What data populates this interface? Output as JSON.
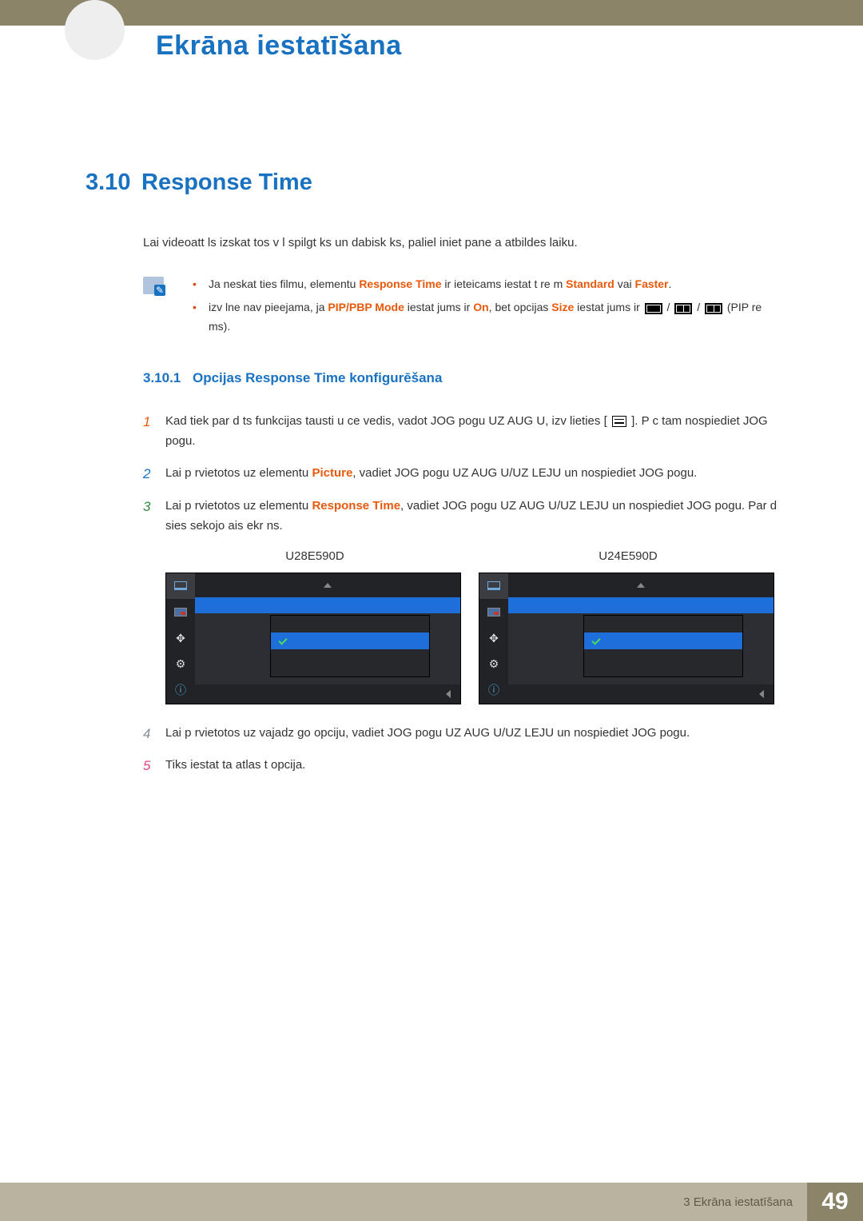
{
  "chapter_title": "Ekrāna iestatīšana",
  "section": {
    "num": "3.10",
    "title": "Response Time"
  },
  "intro": "Lai videoatt ls izskat tos v l spilgt ks un dabisk ks, paliel iniet pane a atbildes laiku.",
  "note1": {
    "prefix": "Ja neskat ties filmu, elementu ",
    "hl1": "Response Time",
    "mid": " ir ieteicams iestat t re m ",
    "hl2": "Standard",
    "or": " vai ",
    "hl3": "Faster",
    "end": "."
  },
  "note2": {
    "prefix": " izv lne nav pieejama, ja ",
    "hl1": "PIP/PBP Mode",
    "mid1": " iestat jums ir ",
    "hl2": "On",
    "mid2": ", bet opcijas ",
    "hl3": "Size",
    "mid3": " iestat jums ir ",
    "end": " (PIP re ms)."
  },
  "subsection": {
    "num": "3.10.1",
    "title": "Opcijas Response Time konfigurēšana"
  },
  "steps": {
    "s1a": "Kad tiek par d ts funkcijas tausti u ce vedis, vadot JOG pogu UZ AUG U, izv lieties ",
    "s1b": " ]. P c tam nospiediet JOG pogu.",
    "s2a": "Lai p rvietotos uz elementu ",
    "s2hl": "Picture",
    "s2b": ", vadiet JOG pogu UZ AUG U/UZ LEJU un nospiediet JOG pogu.",
    "s3a": "Lai p rvietotos uz elementu ",
    "s3hl": "Response Time",
    "s3b": ", vadiet JOG pogu UZ AUG U/UZ LEJU un nospiediet JOG pogu. Par d sies sekojo ais ekr ns.",
    "s4": "Lai p rvietotos uz vajadz go opciju, vadiet JOG pogu UZ AUG U/UZ LEJU un nospiediet JOG pogu.",
    "s5": "Tiks iestat ta atlas t opcija."
  },
  "models": {
    "a": "U28E590D",
    "b": "U24E590D"
  },
  "footer": {
    "chapter": "3 Ekrāna iestatīšana",
    "page": "49"
  }
}
